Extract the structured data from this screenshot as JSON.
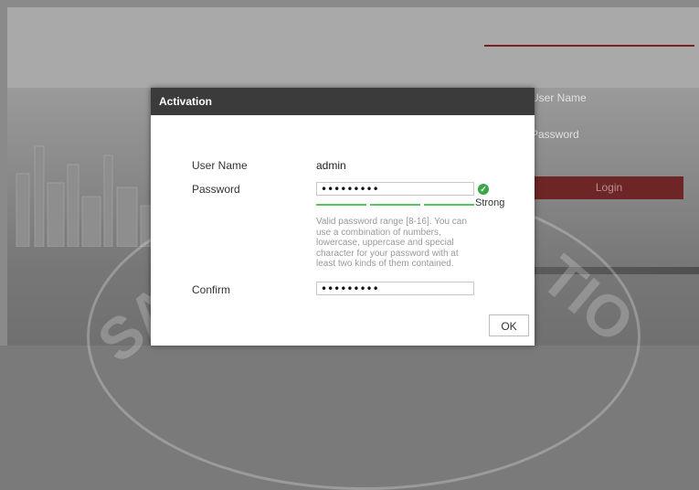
{
  "background": {
    "username_label": "User Name",
    "password_label": "Password",
    "login_label": "Login",
    "watermark_text": "SAM DISTRIBUTION"
  },
  "dialog": {
    "title": "Activation",
    "username_label": "User Name",
    "username_value": "admin",
    "password_label": "Password",
    "password_value": "•••••••••",
    "strength_label": "Strong",
    "strength_level": 1.0,
    "hint": "Valid password range [8-16]. You can use a combination of numbers, lowercase, uppercase and special character for your password with at least two kinds of them contained.",
    "confirm_label": "Confirm",
    "confirm_value": "•••••••••",
    "ok_label": "OK"
  },
  "colors": {
    "title_bar": "#3b3b3b",
    "strength_bar": "#52c46a",
    "check": "#3aa64a",
    "login_button": "#6e2525"
  },
  "icons": {
    "valid": "check-circle-icon"
  }
}
